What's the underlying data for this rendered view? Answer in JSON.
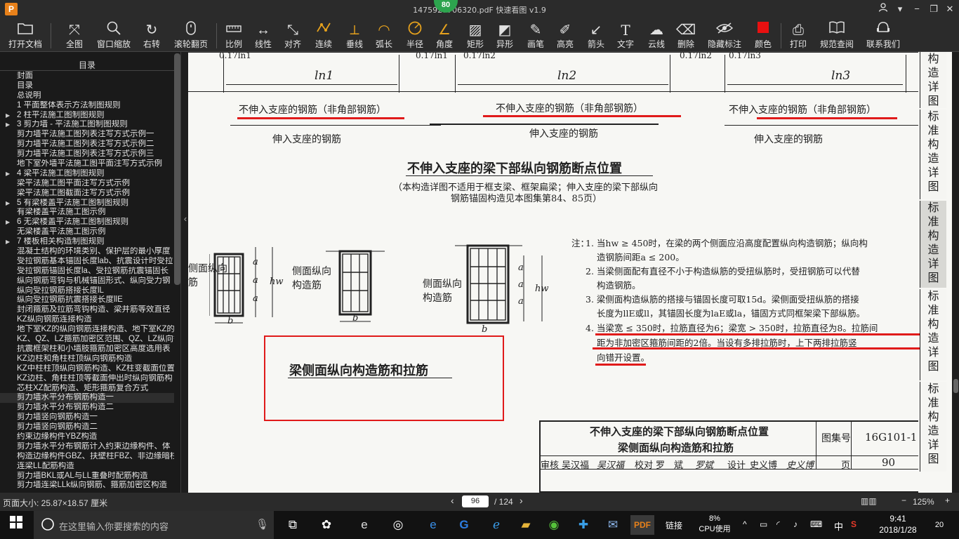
{
  "app": {
    "window_title": "1475927706320.pdf - PDF 快速看图 v1.9",
    "title_display": "1475927706320.pd⁠⁠F  快速看图 v1.9",
    "badge": "80",
    "logo": "P"
  },
  "toolbar": [
    {
      "label": "打开文档",
      "icon": "folder-icon"
    },
    {
      "label": "全图",
      "icon": "fit-all-icon"
    },
    {
      "label": "窗口缩放",
      "icon": "zoom-window-icon"
    },
    {
      "label": "右转",
      "icon": "rotate-right-icon"
    },
    {
      "label": "滚轮翻页",
      "icon": "mouse-wheel-icon"
    },
    {
      "label": "比例",
      "icon": "scale-icon"
    },
    {
      "label": "线性",
      "icon": "linear-measure-icon"
    },
    {
      "label": "对齐",
      "icon": "aligned-measure-icon"
    },
    {
      "label": "连续",
      "icon": "continuous-measure-icon"
    },
    {
      "label": "垂线",
      "icon": "perpendicular-icon"
    },
    {
      "label": "弧长",
      "icon": "arc-length-icon"
    },
    {
      "label": "半径",
      "icon": "radius-icon"
    },
    {
      "label": "角度",
      "icon": "angle-icon"
    },
    {
      "label": "矩形",
      "icon": "rectangle-area-icon"
    },
    {
      "label": "异形",
      "icon": "irregular-area-icon"
    },
    {
      "label": "画笔",
      "icon": "pencil-icon"
    },
    {
      "label": "高亮",
      "icon": "highlight-icon"
    },
    {
      "label": "箭头",
      "icon": "arrow-icon"
    },
    {
      "label": "文字",
      "icon": "text-icon"
    },
    {
      "label": "云线",
      "icon": "cloud-line-icon"
    },
    {
      "label": "删除",
      "icon": "eraser-icon"
    },
    {
      "label": "隐藏标注",
      "icon": "hide-annotation-icon"
    },
    {
      "label": "颜色",
      "icon": "color-swatch-icon",
      "color": "#e81010"
    },
    {
      "label": "打印",
      "icon": "printer-icon"
    },
    {
      "label": "规范查阅",
      "icon": "book-icon"
    },
    {
      "label": "联系我们",
      "icon": "contact-icon"
    }
  ],
  "sidebar": {
    "title": "目录",
    "items": [
      {
        "label": "封面",
        "arrow": false
      },
      {
        "label": "目录",
        "arrow": false
      },
      {
        "label": "总说明",
        "arrow": false
      },
      {
        "label": "1 平面整体表示方法制图规则",
        "arrow": false
      },
      {
        "label": "2 柱平法施工图制图规则",
        "arrow": true
      },
      {
        "label": "3 剪力墙 - 平法施工图制图规则",
        "arrow": true
      },
      {
        "label": "剪力墙平法施工图列表注写方式示例一",
        "arrow": false
      },
      {
        "label": "剪力墙平法施工图列表注写方式示例二",
        "arrow": false
      },
      {
        "label": "剪力墙平法施工图列表注写方式示例三",
        "arrow": false
      },
      {
        "label": "地下室外墙平法施工图平面注写方式示例",
        "arrow": false
      },
      {
        "label": "4 梁平法施工图制图规则",
        "arrow": true
      },
      {
        "label": "梁平法施工图平面注写方式示例",
        "arrow": false
      },
      {
        "label": "梁平法施工图截面注写方式示例",
        "arrow": false
      },
      {
        "label": "5 有梁楼盖平法施工图制图规则",
        "arrow": true
      },
      {
        "label": "有梁楼盖平法施工图示例",
        "arrow": false
      },
      {
        "label": "6 无梁楼盖平法施工图制图规则",
        "arrow": true
      },
      {
        "label": "无梁楼盖平法施工图示例",
        "arrow": false
      },
      {
        "label": "7 楼板相关构造制图规则",
        "arrow": true
      },
      {
        "label": "混凝土结构的环境类别、保护层的最小厚度",
        "arrow": false
      },
      {
        "label": "受拉钢筋基本锚固长度lab、抗震设计时受拉",
        "arrow": false
      },
      {
        "label": "受拉钢筋锚固长度la、受拉钢筋抗震锚固长",
        "arrow": false
      },
      {
        "label": "纵向钢筋弯钩与机械锚固形式、纵向受力钢",
        "arrow": false
      },
      {
        "label": "纵向受拉钢筋搭接长度lL",
        "arrow": false
      },
      {
        "label": "纵向受拉钢筋抗震搭接长度llE",
        "arrow": false
      },
      {
        "label": "封闭箍筋及拉筋弯钩构造、梁并筋等效直径",
        "arrow": false
      },
      {
        "label": "KZ纵向钢筋连接构造",
        "arrow": false
      },
      {
        "label": "地下室KZ的纵向钢筋连接构造、地下室KZ的",
        "arrow": false
      },
      {
        "label": "KZ、QZ、LZ箍筋加密区范围、QZ、LZ纵向钢",
        "arrow": false
      },
      {
        "label": "抗震框架柱和小墙肢箍筋加密区高度选用表",
        "arrow": false
      },
      {
        "label": "KZ边柱和角柱柱顶纵向钢筋构造",
        "arrow": false
      },
      {
        "label": "KZ中柱柱顶纵向钢筋构造、KZ柱变截面位置",
        "arrow": false
      },
      {
        "label": "KZ边柱、角柱柱顶等截面伸出时纵向钢筋构",
        "arrow": false
      },
      {
        "label": "芯柱XZ配筋构造、矩形箍筋复合方式",
        "arrow": false
      },
      {
        "label": "剪力墙水平分布钢筋构造一",
        "arrow": false,
        "selected": true
      },
      {
        "label": "剪力墙水平分布钢筋构造二",
        "arrow": false
      },
      {
        "label": "剪力墙竖向钢筋构造一",
        "arrow": false
      },
      {
        "label": "剪力墙竖向钢筋构造二",
        "arrow": false
      },
      {
        "label": "约束边缘构件YBZ构造",
        "arrow": false
      },
      {
        "label": "剪力墙水平分布钢筋计入约束边缘构件、体",
        "arrow": false
      },
      {
        "label": "构造边缘构件GBZ、扶壁柱FBZ、非边缘暗柱",
        "arrow": false
      },
      {
        "label": "连梁LL配筋构造",
        "arrow": false
      },
      {
        "label": "剪力墙BKL或AL与LL重叠时配筋构造",
        "arrow": false
      },
      {
        "label": "剪力墙连梁LLk纵向钢筋、箍筋加密区构造",
        "arrow": false
      }
    ]
  },
  "document": {
    "top_dims": [
      "0.17ln1",
      "0.17ln1",
      "0.17ln2",
      "0.17ln2",
      "0.17ln3"
    ],
    "spans": [
      "ln1",
      "ln2",
      "ln3"
    ],
    "not_into_support": [
      "不伸入支座的钢筋（非角部钢筋）",
      "不伸入支座的钢筋（非角部钢筋）",
      "不伸入支座的钢筋（非角部钢筋）"
    ],
    "into_support": [
      "伸入支座的钢筋",
      "伸入支座的钢筋",
      "伸入支座的钢筋"
    ],
    "section_title": "不伸入支座的梁下部纵向钢筋断点位置",
    "section_note_1": "（本构造详图不适用于框支梁、框架扁梁；伸入支座的梁下部纵向",
    "section_note_2": "钢筋锚固构造见本图集第84、85页）",
    "labels": {
      "side_long": "侧面纵向",
      "bar": "筋",
      "construct_bar": "构造筋",
      "side_long_2": "侧面纵向",
      "construct_bar_2": "构造筋",
      "a": "a",
      "b": "b",
      "hw": "hw"
    },
    "notes_label": "注：",
    "notes": [
      "1. 当hw ≥ 450时，在梁的两个侧面应沿高度配置纵向构造钢筋；纵向构",
      "造钢筋间距a ≤ 200。",
      "2. 当梁侧面配有直径不小于构造纵筋的受扭纵筋时，受扭钢筋可以代替",
      "构造钢筋。",
      "3. 梁侧面构造纵筋的搭接与锚固长度可取15d。梁侧面受扭纵筋的搭接",
      "长度为llE或ll，其锚固长度为laE或la，锚固方式同框架梁下部纵筋。",
      "4. 当梁宽 ≤ 350时，拉筋直径为6；梁宽 > 350时，拉筋直径为8。拉筋间",
      "距为非加密区箍筋间距的2倍。当设有多排拉筋时，上下两排拉筋竖",
      "向错开设置。"
    ],
    "boxed_title": "梁侧面纵向构造筋和拉筋",
    "title_block": {
      "line1": "不伸入支座的梁下部纵向钢筋断点位置",
      "line2": "梁侧面纵向构造筋和拉筋",
      "atlas_label": "图集号",
      "atlas_no": "16G101-1",
      "page_label": "页",
      "page_no": "90",
      "review": "审核",
      "review_name": "吴汉福",
      "review_sign": "吴汉福",
      "check": "校对",
      "check_name": "罗　斌",
      "check_sign": "罗斌",
      "design": "设计",
      "design_name": "史义博",
      "design_sign": "史义博"
    },
    "tabs": [
      "构造详图",
      "标准构造详图",
      "标准构造详图",
      "标准构造详图",
      "标准构造详图"
    ]
  },
  "status": {
    "page_size": "页面大小: 25.87×18.57 厘米",
    "current_page": "96",
    "total_pages": "/ 124",
    "zoom": "125%"
  },
  "taskbar": {
    "search_placeholder": "在这里输入你要搜索的内容",
    "link_label": "链接",
    "cpu_percent": "8%",
    "cpu_label": "CPU使用",
    "ime": "中",
    "time": "9:41",
    "date": "2018/1/28",
    "notifications": "20"
  }
}
